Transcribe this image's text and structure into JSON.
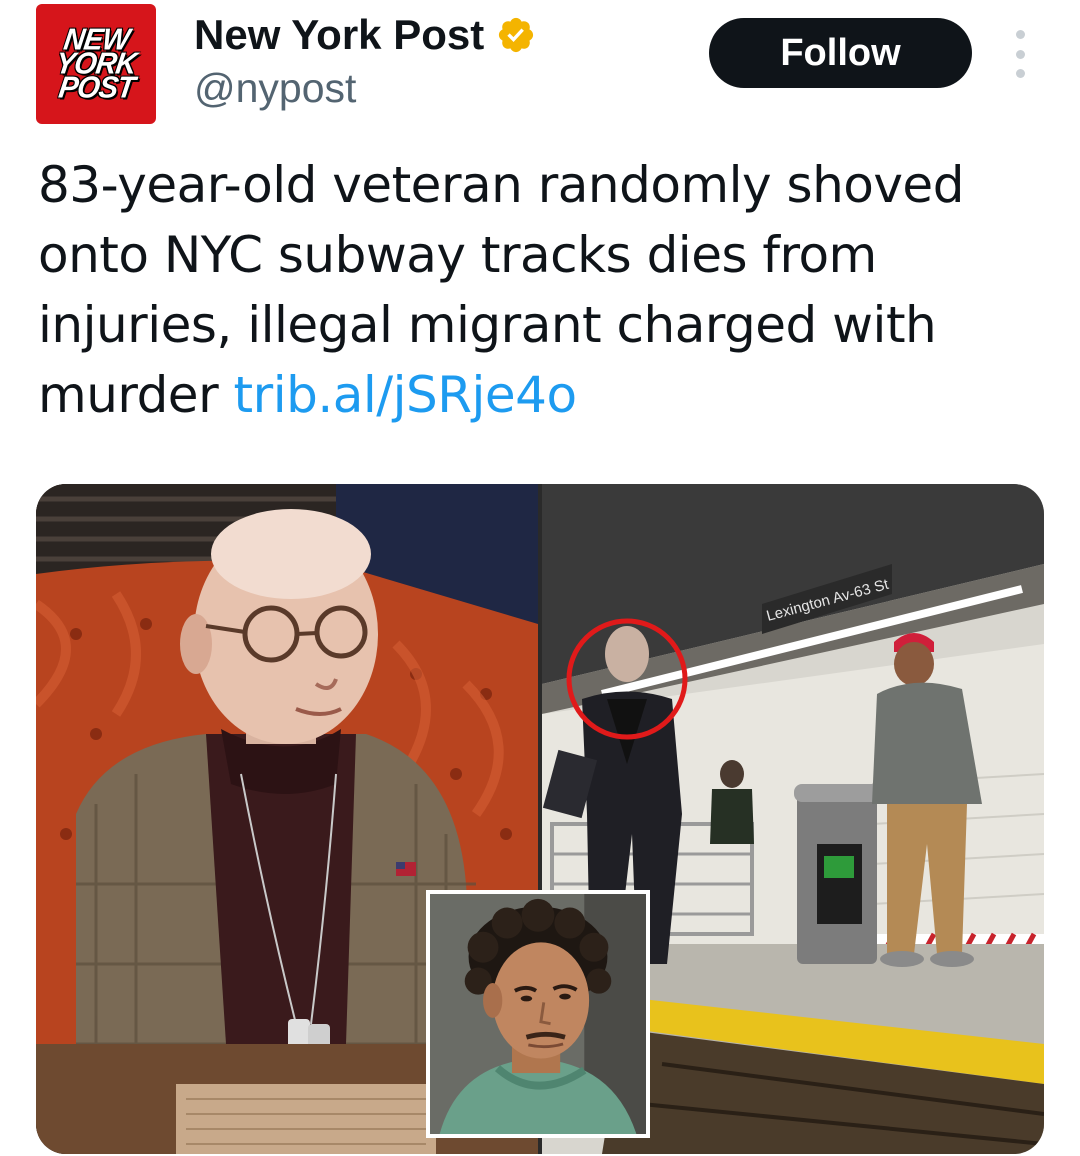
{
  "account": {
    "display_name": "New York Post",
    "handle": "@nypost",
    "verified": true,
    "verified_color": "#f4b400",
    "avatar_logo_lines": [
      "NEW",
      "YORK",
      "POST"
    ],
    "avatar_color": "#d6151b"
  },
  "actions": {
    "follow_label": "Follow",
    "more_icon": "more-vertical-icon"
  },
  "tweet": {
    "text": "83-year-old veteran randomly shoved onto NYC subway tracks dies from injuries, illegal migrant charged with murder",
    "link": "trib.al/jSRje4o",
    "link_color": "#1d9bf0"
  },
  "media": {
    "station_sign": "Lexington Av-63 St"
  }
}
